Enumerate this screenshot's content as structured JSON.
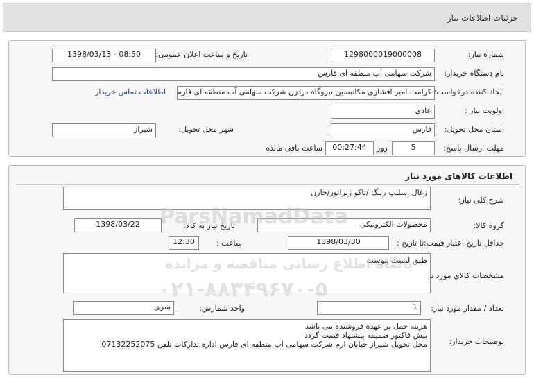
{
  "header": {
    "title": "جزئیات اطلاعات نیاز"
  },
  "info": {
    "need_number_label": "شماره نیاز:",
    "need_number": "1298000019000008",
    "announce_label": "تاریخ و ساعت اعلان عمومی:",
    "announce_value": "1398/03/13 - 08:50",
    "buyer_label": "نام دستگاه خریدار:",
    "buyer_value": "شرکت سهامی آب منطقه ای فارس",
    "creator_label": "ایجاد کننده درخواست:",
    "creator_value": "کرامت امیر افشاری مکانیسین نیروگاه دردزن شرکت سهامی آب منطقه ای فارس",
    "contact_link": "اطلاعات تماس خریدار",
    "priority_label": "اولویت نیاز :",
    "priority_value": "عادي",
    "province_label": "استان محل تحویل:",
    "province_value": "فارس",
    "city_label": "شهر محل تحویل:",
    "city_value": "شیراز",
    "deadline_label": "مهلت ارسال پاسخ:",
    "days_value": "5",
    "days_unit": "روز و",
    "time_value": "00:27:44",
    "time_unit": "ساعت باقی مانده"
  },
  "goods": {
    "section_title": "اطلاعات کالاهای مورد نیاز",
    "summary_label": "شرح کلی نیاز:",
    "summary_value": "زغال اسلیپ رینگ /تاکو ژنراتور/جازن",
    "group_label": "گروه کالا:",
    "group_value": "محصولات الکترونیکی",
    "need_date_label": "تاریخ نیاز به کالا:",
    "need_date_value": "1398/03/22",
    "validity_label": "حداقل تاریخ اعتبار قیمت:",
    "until_date_label": "تا تاریخ :",
    "until_date_value": "1398/03/30",
    "hour_label": "ساعت :",
    "hour_value": "12:30",
    "spec_label": "مشخصات کالاي مورد نیاز:",
    "spec_value": "طبق لیست پیوست",
    "qty_label": "تعداد / مقدار مورد نیاز:",
    "qty_value": "1",
    "unit_label": "واحد شمارش:",
    "unit_value": "سری",
    "notes_label": "توضیحات خریدار:",
    "notes_lines": [
      "هزینه حمل بر عهده فروشنده می باشد",
      "پیش فاکتور ضمیمه پیشنهاد قیمت گردد",
      "محل تحویل شیراز خیابان ارم شرکت سهامی اب منطقه ای فارس اداره تدارکات تلفن 07132252075"
    ]
  },
  "watermark": {
    "line1": "ParsNamadData",
    "line2": "پایگاه اطلاع رسانی مناقصه و مزایده",
    "line3": "۰۲۱-۸۸۳۴۹۶۷۰-۵"
  }
}
